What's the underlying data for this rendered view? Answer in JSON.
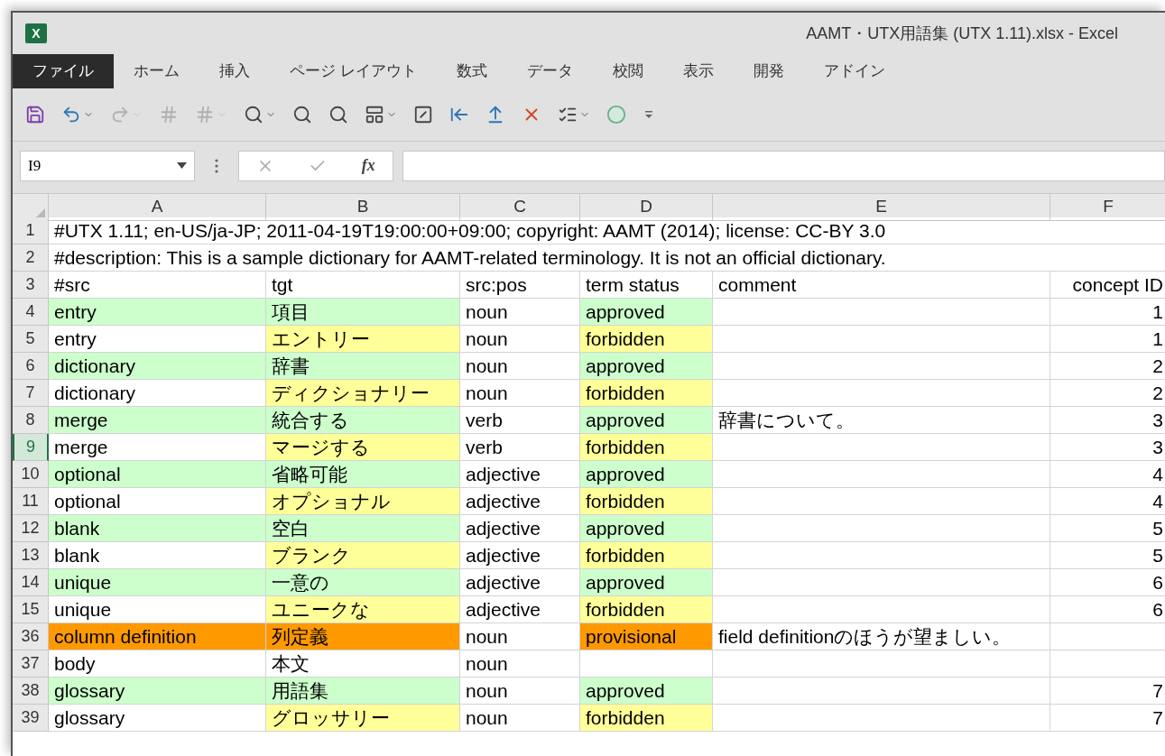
{
  "window": {
    "title": "AAMT・UTX用語集 (UTX 1.11).xlsx - Excel",
    "logo_letter": "X"
  },
  "ribbon_tabs": [
    {
      "label": "ファイル",
      "selected": true
    },
    {
      "label": "ホーム",
      "selected": false
    },
    {
      "label": "挿入",
      "selected": false
    },
    {
      "label": "ページ レイアウト",
      "selected": false
    },
    {
      "label": "数式",
      "selected": false
    },
    {
      "label": "データ",
      "selected": false
    },
    {
      "label": "校閲",
      "selected": false
    },
    {
      "label": "表示",
      "selected": false
    },
    {
      "label": "開発",
      "selected": false
    },
    {
      "label": "アドイン",
      "selected": false
    }
  ],
  "quick_access": [
    {
      "kind": "save",
      "disabled": false
    },
    {
      "kind": "undo",
      "caret": true,
      "disabled": false
    },
    {
      "kind": "redo",
      "caret": true,
      "disabled": true
    },
    {
      "kind": "hash",
      "disabled": true
    },
    {
      "kind": "hash",
      "caret": true,
      "disabled": true
    },
    {
      "kind": "zoom",
      "caret": true,
      "disabled": false
    },
    {
      "kind": "zoom",
      "disabled": false
    },
    {
      "kind": "zoom",
      "disabled": false
    },
    {
      "kind": "layout",
      "caret": true,
      "disabled": false
    },
    {
      "kind": "diagonal",
      "disabled": false
    },
    {
      "kind": "indent",
      "disabled": false
    },
    {
      "kind": "stretch",
      "disabled": false
    },
    {
      "kind": "delete",
      "disabled": false
    },
    {
      "kind": "checklist",
      "caret": true,
      "disabled": false
    },
    {
      "kind": "circle",
      "disabled": false
    },
    {
      "kind": "customize"
    }
  ],
  "formula_bar": {
    "name_box": "I9",
    "fx": "fx"
  },
  "sheet": {
    "columns": [
      "A",
      "B",
      "C",
      "D",
      "E",
      "F"
    ],
    "rows": [
      {
        "header": "1",
        "selected": false,
        "cells": [
          {
            "text": "#UTX 1.11; en-US/ja-JP; 2011-04-19T19:00:00+09:00; copyright: AAMT (2014); license: CC-BY 3.0"
          }
        ]
      },
      {
        "header": "2",
        "selected": false,
        "cells": [
          {
            "text": "#description: This is a sample dictionary for AAMT-related terminology. It is not an official dictionary."
          }
        ]
      },
      {
        "header": "3",
        "selected": false,
        "cells": [
          {
            "text": "#src"
          },
          {
            "text": "tgt"
          },
          {
            "text": "src:pos"
          },
          {
            "text": "term status"
          },
          {
            "text": "comment"
          },
          {
            "text": "concept ID"
          }
        ]
      },
      {
        "header": "4",
        "selected": false,
        "cells": [
          {
            "text": "entry",
            "color": "#ccffcc"
          },
          {
            "text": "項目",
            "color": "#ccffcc"
          },
          {
            "text": "noun"
          },
          {
            "text": "approved",
            "color": "#ccffcc"
          },
          null,
          {
            "text": "1"
          }
        ]
      },
      {
        "header": "5",
        "selected": false,
        "cells": [
          {
            "text": "entry"
          },
          {
            "text": "エントリー",
            "color": "#ffff99"
          },
          {
            "text": "noun"
          },
          {
            "text": "forbidden",
            "color": "#ffff99"
          },
          null,
          {
            "text": "1"
          }
        ]
      },
      {
        "header": "6",
        "selected": false,
        "cells": [
          {
            "text": "dictionary",
            "color": "#ccffcc"
          },
          {
            "text": "辞書",
            "color": "#ccffcc"
          },
          {
            "text": "noun"
          },
          {
            "text": "approved",
            "color": "#ccffcc"
          },
          null,
          {
            "text": "2"
          }
        ]
      },
      {
        "header": "7",
        "selected": false,
        "cells": [
          {
            "text": "dictionary"
          },
          {
            "text": "ディクショナリー",
            "color": "#ffff99"
          },
          {
            "text": "noun"
          },
          {
            "text": "forbidden",
            "color": "#ffff99"
          },
          null,
          {
            "text": "2"
          }
        ]
      },
      {
        "header": "8",
        "selected": false,
        "cells": [
          {
            "text": "merge",
            "color": "#ccffcc"
          },
          {
            "text": "統合する",
            "color": "#ccffcc"
          },
          {
            "text": "verb"
          },
          {
            "text": "approved",
            "color": "#ccffcc"
          },
          {
            "text": "辞書について。"
          },
          {
            "text": "3"
          }
        ]
      },
      {
        "header": "9",
        "selected": true,
        "cells": [
          {
            "text": "merge"
          },
          {
            "text": "マージする",
            "color": "#ffff99"
          },
          {
            "text": "verb"
          },
          {
            "text": "forbidden",
            "color": "#ffff99"
          },
          null,
          {
            "text": "3"
          }
        ]
      },
      {
        "header": "10",
        "selected": false,
        "cells": [
          {
            "text": "optional",
            "color": "#ccffcc"
          },
          {
            "text": "省略可能",
            "color": "#ccffcc"
          },
          {
            "text": "adjective"
          },
          {
            "text": "approved",
            "color": "#ccffcc"
          },
          null,
          {
            "text": "4"
          }
        ]
      },
      {
        "header": "11",
        "selected": false,
        "cells": [
          {
            "text": "optional"
          },
          {
            "text": "オプショナル",
            "color": "#ffff99"
          },
          {
            "text": "adjective"
          },
          {
            "text": "forbidden",
            "color": "#ffff99"
          },
          null,
          {
            "text": "4"
          }
        ]
      },
      {
        "header": "12",
        "selected": false,
        "cells": [
          {
            "text": "blank",
            "color": "#ccffcc"
          },
          {
            "text": "空白",
            "color": "#ccffcc"
          },
          {
            "text": "adjective"
          },
          {
            "text": "approved",
            "color": "#ccffcc"
          },
          null,
          {
            "text": "5"
          }
        ]
      },
      {
        "header": "13",
        "selected": false,
        "cells": [
          {
            "text": "blank"
          },
          {
            "text": "ブランク",
            "color": "#ffff99"
          },
          {
            "text": "adjective"
          },
          {
            "text": "forbidden",
            "color": "#ffff99"
          },
          null,
          {
            "text": "5"
          }
        ]
      },
      {
        "header": "14",
        "selected": false,
        "cells": [
          {
            "text": "unique",
            "color": "#ccffcc"
          },
          {
            "text": "一意の",
            "color": "#ccffcc"
          },
          {
            "text": "adjective"
          },
          {
            "text": "approved",
            "color": "#ccffcc"
          },
          null,
          {
            "text": "6"
          }
        ]
      },
      {
        "header": "15",
        "selected": false,
        "cells": [
          {
            "text": "unique"
          },
          {
            "text": "ユニークな",
            "color": "#ffff99"
          },
          {
            "text": "adjective"
          },
          {
            "text": "forbidden",
            "color": "#ffff99"
          },
          null,
          {
            "text": "6"
          }
        ]
      },
      {
        "header": "36",
        "selected": false,
        "cells": [
          {
            "text": "column definition",
            "color": "#ff9900"
          },
          {
            "text": "列定義",
            "color": "#ff9900"
          },
          {
            "text": "noun"
          },
          {
            "text": "provisional",
            "color": "#ff9900"
          },
          {
            "text": "field definitionのほうが望ましい。"
          },
          null
        ]
      },
      {
        "header": "37",
        "selected": false,
        "cells": [
          {
            "text": "body"
          },
          {
            "text": "本文"
          },
          {
            "text": "noun"
          },
          null,
          null,
          null
        ]
      },
      {
        "header": "38",
        "selected": false,
        "cells": [
          {
            "text": "glossary",
            "color": "#ccffcc"
          },
          {
            "text": "用語集",
            "color": "#ccffcc"
          },
          {
            "text": "noun"
          },
          {
            "text": "approved",
            "color": "#ccffcc"
          },
          null,
          {
            "text": "7"
          }
        ]
      },
      {
        "header": "39",
        "selected": false,
        "cells": [
          {
            "text": "glossary"
          },
          {
            "text": "グロッサリー",
            "color": "#ffff99"
          },
          {
            "text": "noun"
          },
          {
            "text": "forbidden",
            "color": "#ffff99"
          },
          null,
          {
            "text": "7"
          }
        ]
      }
    ]
  }
}
